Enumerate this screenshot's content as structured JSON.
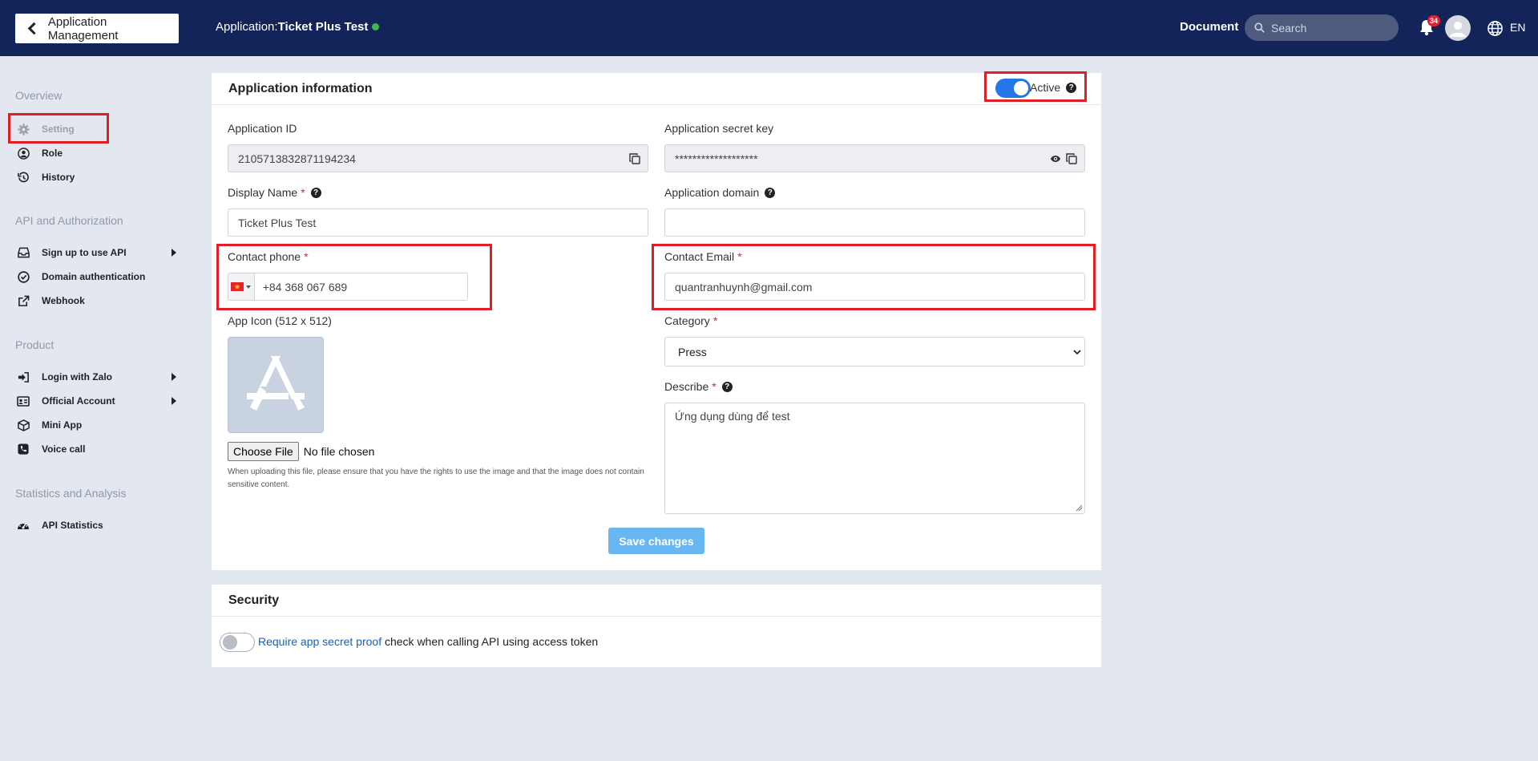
{
  "header": {
    "back_label": "Application Management",
    "app_prefix": "Application:",
    "app_name": "Ticket Plus Test",
    "document_label": "Document",
    "search_placeholder": "Search",
    "notification_count": "34",
    "language": "EN",
    "status_color": "#3fb850"
  },
  "sidebar": {
    "sections": [
      {
        "title": "Overview",
        "items": [
          {
            "label": "Setting",
            "icon": "gear-icon"
          },
          {
            "label": "Role",
            "icon": "user-circle-icon"
          },
          {
            "label": "History",
            "icon": "history-icon"
          }
        ]
      },
      {
        "title": "API and Authorization",
        "items": [
          {
            "label": "Sign up to use API",
            "icon": "inbox-icon"
          },
          {
            "label": "Domain authentication",
            "icon": "check-circle-icon"
          },
          {
            "label": "Webhook",
            "icon": "external-link-icon"
          }
        ]
      },
      {
        "title": "Product",
        "items": [
          {
            "label": "Login with Zalo",
            "icon": "sign-in-icon"
          },
          {
            "label": "Official Account",
            "icon": "id-card-icon"
          },
          {
            "label": "Mini App",
            "icon": "cube-icon"
          },
          {
            "label": "Voice call",
            "icon": "phone-icon"
          }
        ]
      },
      {
        "title": "Statistics and Analysis",
        "items": [
          {
            "label": "API Statistics",
            "icon": "gauge-icon"
          }
        ]
      }
    ]
  },
  "app_info": {
    "title": "Application information",
    "active_label": "Active",
    "app_id_label": "Application ID",
    "app_id": "2105713832871194234",
    "secret_label": "Application secret key",
    "secret_value": "*******************",
    "display_name_label": "Display Name",
    "display_name": "Ticket Plus Test",
    "domain_label": "Application domain",
    "domain_value": "",
    "phone_label": "Contact phone",
    "phone_value": "+84 368 067 689",
    "email_label": "Contact Email",
    "email_value": "quantranhuynh@gmail.com",
    "icon_label": "App Icon (512 x 512)",
    "choose_file": "Choose File",
    "no_file": "No file chosen",
    "upload_note": "When uploading this file, please ensure that you have the rights to use the image and that the image does not contain sensitive content.",
    "category_label": "Category",
    "category_value": "Press",
    "describe_label": "Describe",
    "describe_value": "Ứng dụng dùng để test",
    "save_label": "Save changes"
  },
  "security": {
    "title": "Security",
    "link_text": "Require app secret proof",
    "rest_text": "check when calling API using access token"
  }
}
